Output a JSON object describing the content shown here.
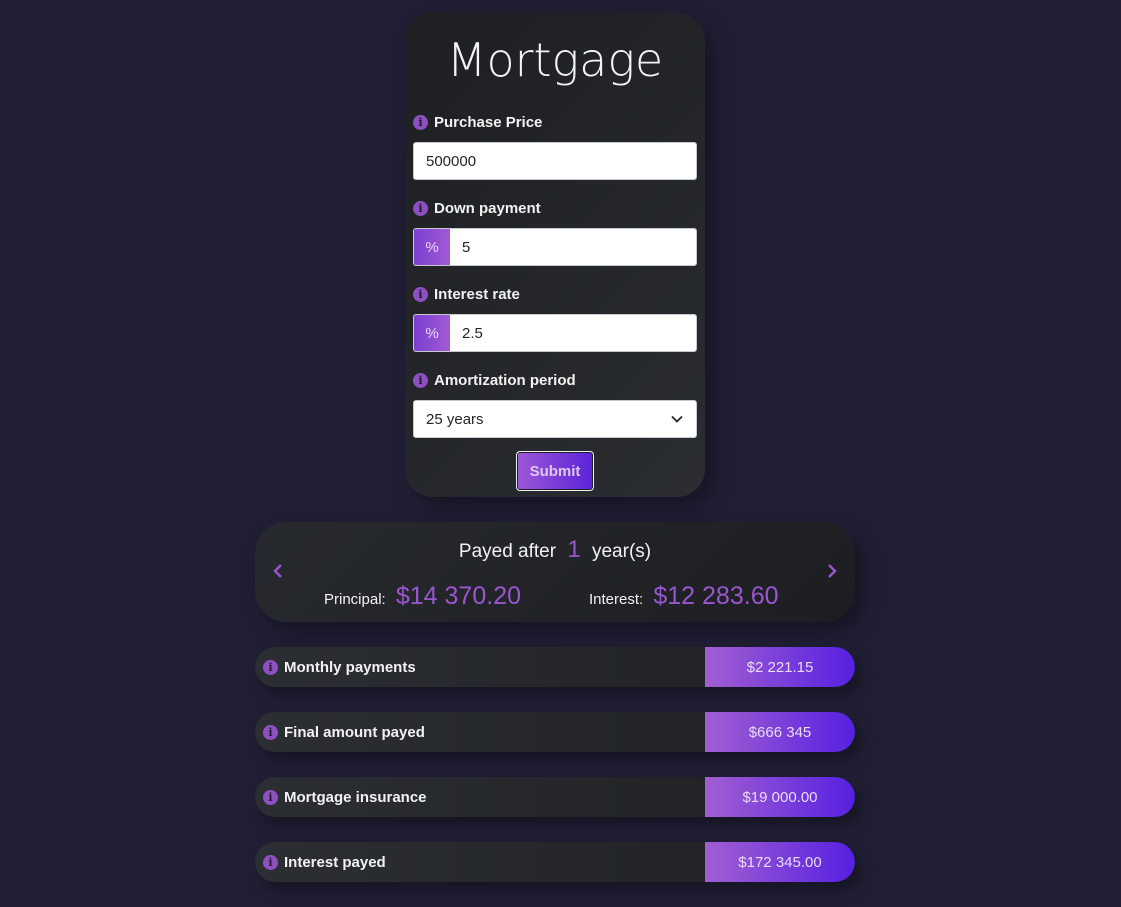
{
  "form": {
    "title": "Mortgage",
    "purchase_price": {
      "label": "Purchase Price",
      "value": "500000"
    },
    "down_payment": {
      "label": "Down payment",
      "addon": "%",
      "value": "5"
    },
    "interest_rate": {
      "label": "Interest rate",
      "addon": "%",
      "value": "2.5"
    },
    "amortization": {
      "label": "Amortization period",
      "selected": "25 years"
    },
    "submit_label": "Submit"
  },
  "payed": {
    "prefix": "Payed after",
    "years": "1",
    "suffix": "year(s)",
    "principal_label": "Principal:",
    "principal_value": "$14 370.20",
    "interest_label": "Interest:",
    "interest_value": "$12 283.60"
  },
  "results": [
    {
      "label": "Monthly payments",
      "value": "$2 221.15"
    },
    {
      "label": "Final amount payed",
      "value": "$666 345"
    },
    {
      "label": "Mortgage insurance",
      "value": "$19 000.00"
    },
    {
      "label": "Interest payed",
      "value": "$172 345.00"
    }
  ],
  "colors": {
    "accent": "#9a55d0",
    "background": "#201f35",
    "card": "#1d1f22"
  },
  "icons": {
    "info": "info-icon",
    "prev": "chevron-left-icon",
    "next": "chevron-right-icon",
    "select": "chevron-down-icon"
  }
}
